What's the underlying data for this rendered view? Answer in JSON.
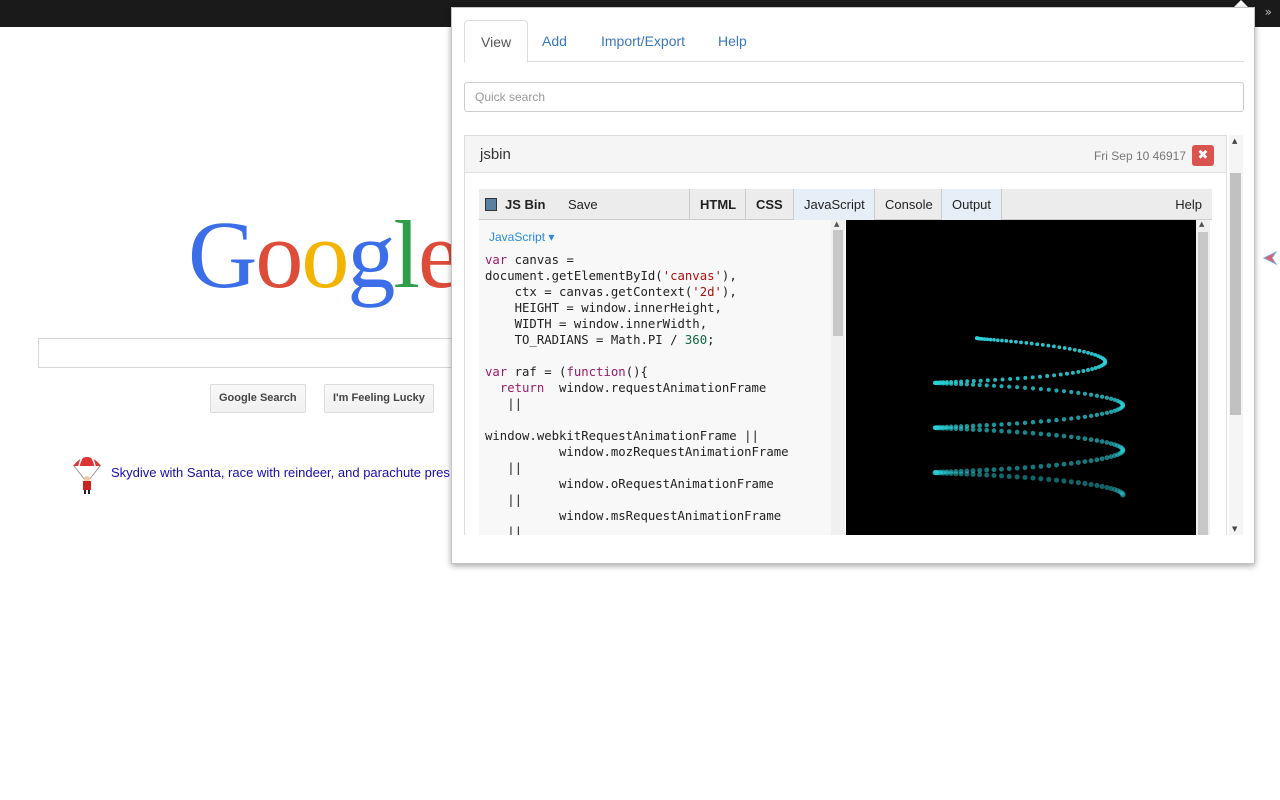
{
  "browser": {
    "overflow_chevron": "»"
  },
  "google": {
    "logo_letters": [
      "G",
      "o",
      "o",
      "g",
      "l",
      "e"
    ],
    "search_button": "Google Search",
    "lucky_button": "I'm Feeling Lucky",
    "doodle_text": "Skydive with Santa, race with reindeer, and parachute pres"
  },
  "popup": {
    "tabs": [
      "View",
      "Add",
      "Import/Export",
      "Help"
    ],
    "active_tab": "View",
    "search_placeholder": "Quick search",
    "item": {
      "title": "jsbin",
      "date": "Fri Sep 10 46917",
      "delete_icon": "✖"
    },
    "jsbin": {
      "brand": "JS Bin",
      "save": "Save",
      "panels": [
        "HTML",
        "CSS",
        "JavaScript",
        "Console",
        "Output"
      ],
      "help": "Help",
      "language": "JavaScript ▾",
      "code_lines": [
        "var canvas =",
        "document.getElementById('canvas'),",
        "    ctx = canvas.getContext('2d'),",
        "    HEIGHT = window.innerHeight,",
        "    WIDTH = window.innerWidth,",
        "    TO_RADIANS = Math.PI / 360;",
        "",
        "var raf = (function(){",
        "  return  window.requestAnimationFrame",
        "   ||",
        "",
        "window.webkitRequestAnimationFrame ||",
        "          window.mozRequestAnimationFrame",
        "   ||",
        "          window.oRequestAnimationFrame",
        "   ||",
        "          window.msRequestAnimationFrame",
        "   ||"
      ]
    }
  },
  "colors": {
    "link": "#3a78b8",
    "spiral": "#2ad0d8",
    "delete": "#d9534f"
  }
}
